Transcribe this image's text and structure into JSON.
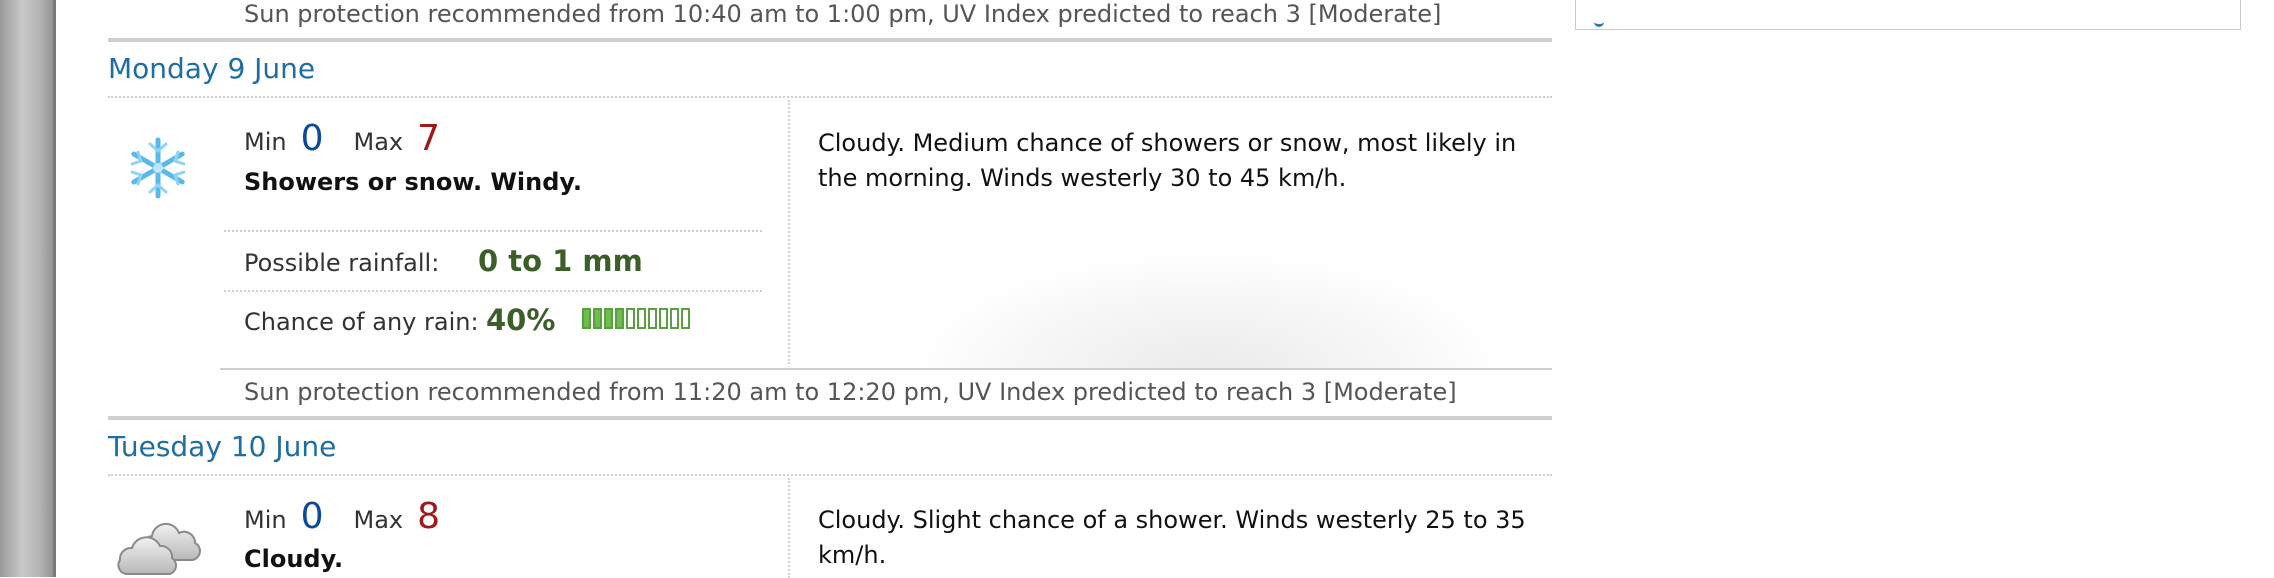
{
  "top_sun_protection": "Sun protection recommended from 10:40 am to 1:00 pm, UV Index predicted to reach 3 [Moderate]",
  "days": [
    {
      "title": "Monday 9 June",
      "icon": "snowflake-icon",
      "min_label": "Min",
      "min": "0",
      "max_label": "Max",
      "max": "7",
      "summary": "Showers or snow. Windy.",
      "rainfall_label": "Possible rainfall:",
      "rainfall": "0 to 1 mm",
      "chance_label": "Chance of any rain:",
      "chance": "40%",
      "chance_fraction": 0.4,
      "description": "Cloudy. Medium chance of showers or snow, most likely in the morning. Winds westerly 30 to 45 km/h.",
      "sun_protection": "Sun protection recommended from 11:20 am to 12:20 pm, UV Index predicted to reach 3 [Moderate]"
    },
    {
      "title": "Tuesday 10 June",
      "icon": "cloud-icon",
      "min_label": "Min",
      "min": "0",
      "max_label": "Max",
      "max": "8",
      "summary": "Cloudy.",
      "description": "Cloudy. Slight chance of a shower. Winds westerly 25 to 35 km/h."
    }
  ],
  "colors": {
    "day_title": "#1f6ea0",
    "min_temp": "#0b4a9b",
    "max_temp": "#a01818",
    "rain_value": "#3c5f2a",
    "rain_bar": "#6cbf4a"
  }
}
